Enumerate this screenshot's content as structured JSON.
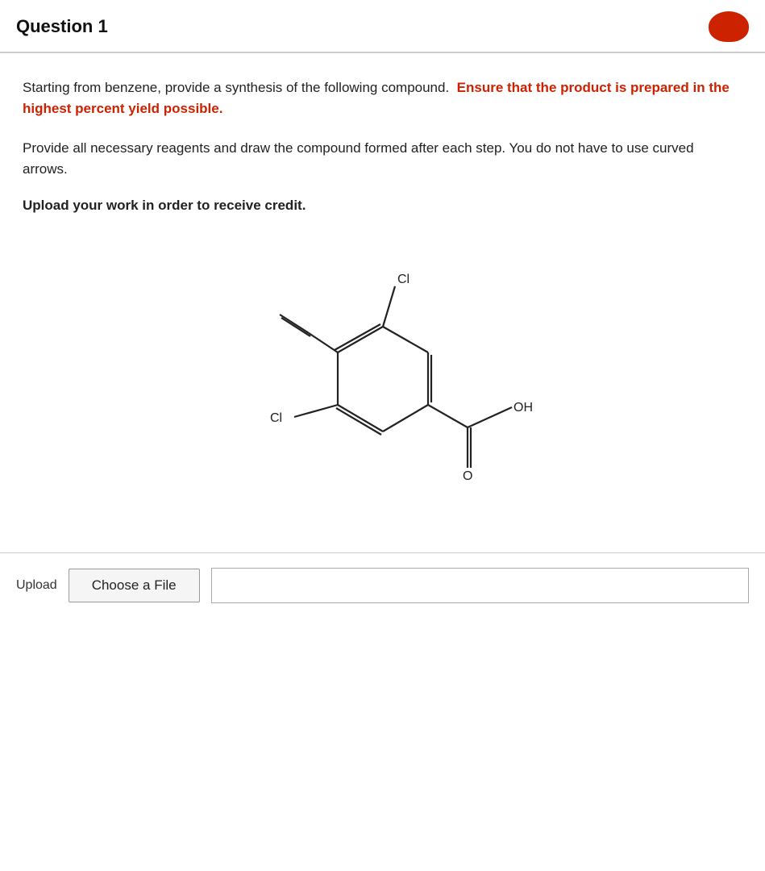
{
  "header": {
    "title": "Question 1"
  },
  "question": {
    "text_part1": "Starting from benzene, provide a synthesis of the following compound.",
    "text_highlight": "Ensure that the product is prepared in the highest percent yield possible.",
    "text_part2": "Provide all necessary reagents and draw the compound formed after each step. You do not have to use curved arrows.",
    "upload_instruction": "Upload your work in order to receive credit."
  },
  "upload": {
    "label": "Upload",
    "button_label": "Choose a File"
  },
  "colors": {
    "accent_red": "#cc2200",
    "border_gray": "#cccccc",
    "bg_white": "#ffffff",
    "bg_light": "#f5f5f5"
  }
}
